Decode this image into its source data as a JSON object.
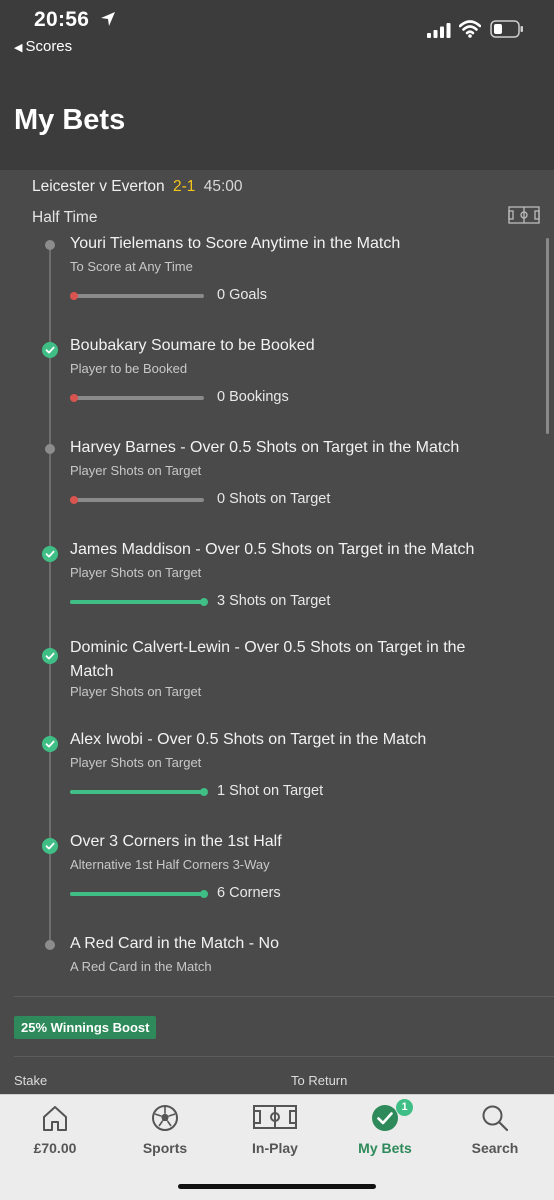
{
  "status_bar": {
    "time": "20:56",
    "back_label": "Scores"
  },
  "header": {
    "title": "My Bets"
  },
  "match": {
    "teams": "Leicester v Everton",
    "score": "2-1",
    "clock": "45:00",
    "period": "Half Time"
  },
  "selections": [
    {
      "title": "Youri Tielemans to Score Anytime in the Match",
      "subtitle": "To Score at Any Time",
      "status": "pending",
      "progress_label": "0 Goals",
      "progress": 0
    },
    {
      "title": "Boubakary Soumare to be Booked",
      "subtitle": "Player to be Booked",
      "status": "won",
      "progress_label": "0 Bookings",
      "progress": 0
    },
    {
      "title": "Harvey Barnes - Over 0.5 Shots on Target in the Match",
      "subtitle": "Player Shots on Target",
      "status": "pending",
      "progress_label": "0 Shots on Target",
      "progress": 0
    },
    {
      "title": "James Maddison - Over 0.5 Shots on Target in the Match",
      "subtitle": "Player Shots on Target",
      "status": "won",
      "progress_label": "3 Shots on Target",
      "progress": 1
    },
    {
      "title": "Dominic Calvert-Lewin - Over 0.5 Shots on Target in the Match",
      "subtitle": "Player Shots on Target",
      "status": "won",
      "progress_label": "",
      "progress": null
    },
    {
      "title": "Alex Iwobi - Over 0.5 Shots on Target in the Match",
      "subtitle": "Player Shots on Target",
      "status": "won",
      "progress_label": "1 Shot on Target",
      "progress": 1
    },
    {
      "title": "Over 3 Corners in the 1st Half",
      "subtitle": "Alternative 1st Half Corners 3-Way",
      "status": "won",
      "progress_label": "6 Corners",
      "progress": 1
    },
    {
      "title": "A Red Card in the Match - No",
      "subtitle": "A Red Card in the Match",
      "status": "pending",
      "progress_label": "",
      "progress": null
    }
  ],
  "boost": {
    "label": "25% Winnings Boost"
  },
  "bet_summary": {
    "stake_label": "Stake",
    "return_label": "To Return"
  },
  "bottom_nav": {
    "items": [
      {
        "label": "£70.00",
        "icon": "home-icon"
      },
      {
        "label": "Sports",
        "icon": "football-icon"
      },
      {
        "label": "In-Play",
        "icon": "pitch-icon"
      },
      {
        "label": "My Bets",
        "icon": "check-circle-icon",
        "badge": "1",
        "active": true
      },
      {
        "label": "Search",
        "icon": "search-icon"
      }
    ]
  },
  "colors": {
    "background": "#4a4a4a",
    "header": "#3c3c3c",
    "accent_green": "#3fbf86",
    "score_yellow": "#f5c518",
    "loss_red": "#d9534f",
    "nav_active": "#2e8a5a"
  }
}
